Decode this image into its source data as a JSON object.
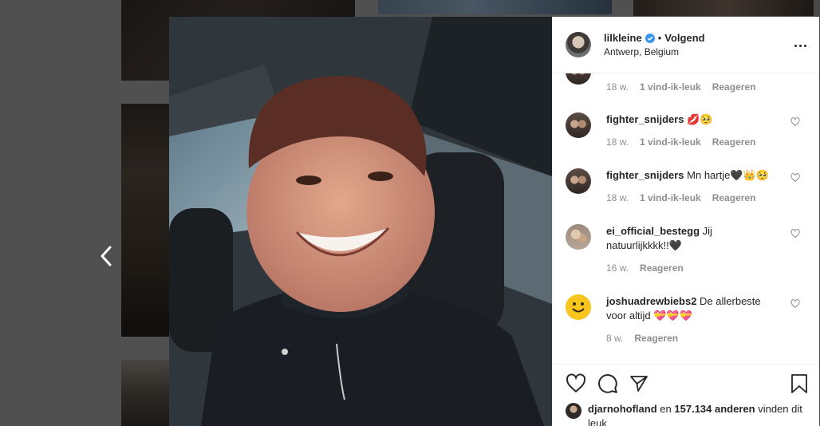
{
  "post": {
    "username": "lilkleine",
    "follow_separator": "•",
    "follow_label": "Volgend",
    "location": "Antwerp, Belgium"
  },
  "comments": [
    {
      "username": "",
      "text": "",
      "age": "18 w.",
      "likes": "1 vind-ik-leuk",
      "reply": "Reageren"
    },
    {
      "username": "fighter_snijders",
      "text": "💋🥺",
      "age": "18 w.",
      "likes": "1 vind-ik-leuk",
      "reply": "Reageren"
    },
    {
      "username": "fighter_snijders",
      "text": "Mn hartje🖤👑🥺",
      "age": "18 w.",
      "likes": "1 vind-ik-leuk",
      "reply": "Reageren"
    },
    {
      "username": "ei_official_bestegg",
      "text": "Jij natuurlijkkkk!!🖤",
      "age": "16 w.",
      "reply": "Reageren"
    },
    {
      "username": "joshuadrewbiebs2",
      "text": "De allerbeste voor altijd 💝💝💝",
      "age": "8 w.",
      "reply": "Reageren"
    }
  ],
  "likes": {
    "first_user": "djarnohofland",
    "connector": "en",
    "count_text": "157.134 anderen",
    "suffix": "vinden dit leuk"
  },
  "icons": {
    "prev": "chevron-left-icon",
    "more": "more-horizontal-icon",
    "like": "heart-icon",
    "comment": "comment-icon",
    "share": "paper-plane-icon",
    "save": "bookmark-icon",
    "verified": "verified-badge-icon"
  },
  "colors": {
    "verified": "#3897f0",
    "text": "#262626",
    "meta": "#8e8e8e",
    "border": "#efefef"
  }
}
